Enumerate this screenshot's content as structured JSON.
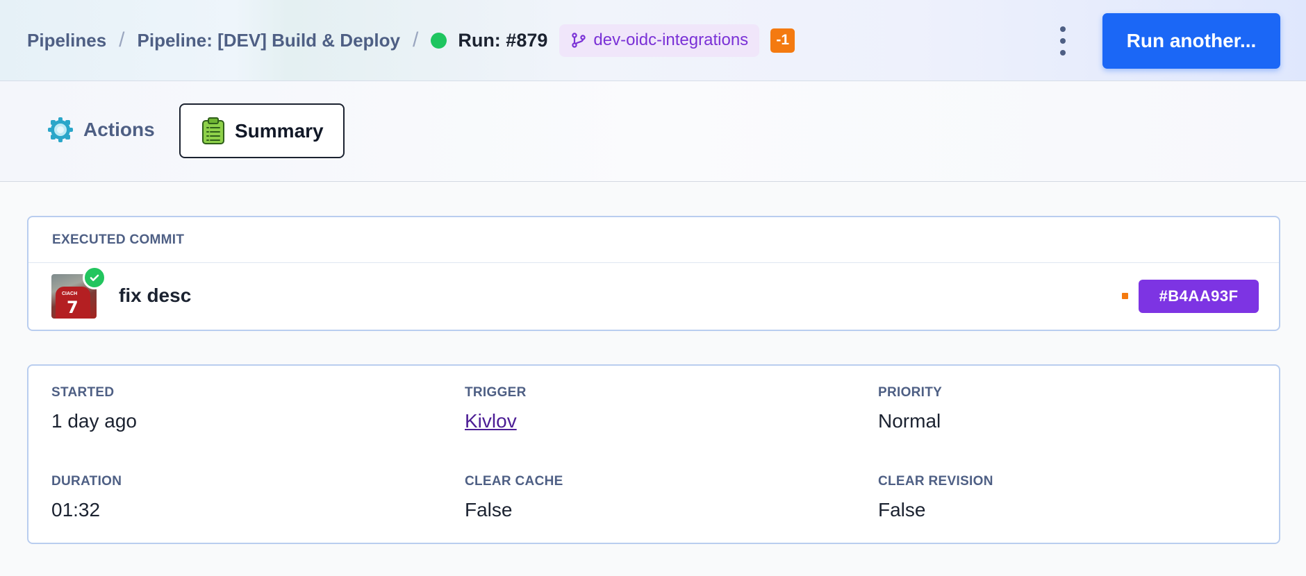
{
  "header": {
    "breadcrumbs": [
      "Pipelines",
      "Pipeline: [DEV] Build & Deploy"
    ],
    "separator": "/",
    "run_label": "Run: #879",
    "branch": "dev-oidc-integrations",
    "count_badge": "-1",
    "run_button_label": "Run another...",
    "status_color": "#1ec55f",
    "accent_color": "#1b67f6"
  },
  "tabs": [
    {
      "label": "Actions",
      "icon": "actions-gear-icon",
      "active": false
    },
    {
      "label": "Summary",
      "icon": "clipboard-icon",
      "active": true
    }
  ],
  "commit": {
    "section_label": "EXECUTED COMMIT",
    "avatar_text": {
      "name": "CIACH",
      "number": "7"
    },
    "message": "fix desc",
    "hash": "#B4AA93F",
    "hash_color": "#7d34e3"
  },
  "details": {
    "started": {
      "label": "STARTED",
      "value": "1 day ago"
    },
    "trigger": {
      "label": "TRIGGER",
      "value": "Kivlov"
    },
    "priority": {
      "label": "PRIORITY",
      "value": "Normal"
    },
    "duration": {
      "label": "DURATION",
      "value": "01:32"
    },
    "clear_cache": {
      "label": "CLEAR CACHE",
      "value": "False"
    },
    "clear_revision": {
      "label": "CLEAR REVISION",
      "value": "False"
    }
  }
}
